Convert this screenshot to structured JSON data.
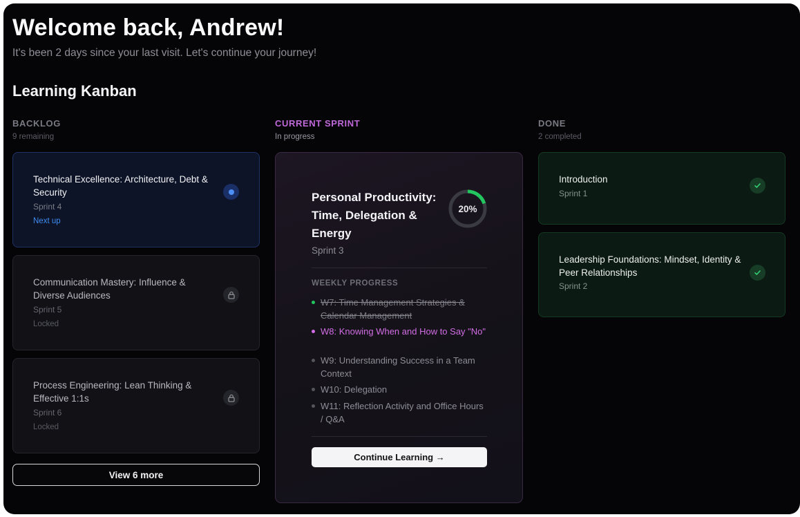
{
  "header": {
    "welcome": "Welcome back, Andrew!",
    "subtitle": "It's been 2 days since your last visit. Let's continue your journey!",
    "section_title": "Learning Kanban"
  },
  "columns": {
    "backlog": {
      "label": "BACKLOG",
      "sub": "9 remaining"
    },
    "current": {
      "label": "CURRENT SPRINT",
      "sub": "In progress"
    },
    "done": {
      "label": "DONE",
      "sub": "2 completed"
    }
  },
  "backlog": {
    "cards": [
      {
        "title": "Technical Excellence: Architecture, Debt & Security",
        "sprint": "Sprint 4",
        "status": "Next up",
        "icon": "dot-icon"
      },
      {
        "title": "Communication Mastery: Influence & Diverse Audiences",
        "sprint": "Sprint 5",
        "status": "Locked",
        "icon": "lock-icon"
      },
      {
        "title": "Process Engineering: Lean Thinking & Effective 1:1s",
        "sprint": "Sprint 6",
        "status": "Locked",
        "icon": "lock-icon"
      }
    ],
    "view_more": "View 6 more"
  },
  "current": {
    "title": "Personal Productivity: Time, Delegation & Energy",
    "sprint": "Sprint 3",
    "progress_percent": 20,
    "progress_label": "20%",
    "weekly_label": "WEEKLY PROGRESS",
    "weeks": [
      {
        "text": "W7: Time Management Strategies & Calendar Management",
        "state": "done"
      },
      {
        "text": "W8: Knowing When and How to Say \"No\"",
        "state": "current"
      },
      {
        "text": "W9: Understanding Success in a Team Context",
        "state": "upcoming"
      },
      {
        "text": "W10: Delegation",
        "state": "upcoming"
      },
      {
        "text": "W11: Reflection Activity and Office Hours / Q&A",
        "state": "upcoming"
      }
    ],
    "continue_label": "Continue Learning →"
  },
  "done": {
    "cards": [
      {
        "title": "Introduction",
        "sprint": "Sprint 1",
        "icon": "check-icon"
      },
      {
        "title": "Leadership Foundations: Mindset, Identity & Peer Relationships",
        "sprint": "Sprint 2",
        "icon": "check-icon"
      }
    ]
  },
  "colors": {
    "accent_purple": "#d26ee5",
    "accent_blue": "#4d8ff5",
    "accent_green": "#22c55e",
    "background": "#050407"
  }
}
